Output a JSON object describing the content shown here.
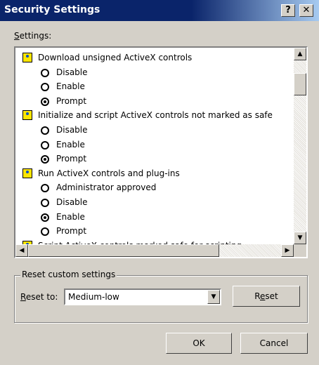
{
  "window": {
    "title": "Security Settings",
    "help_label": "?",
    "close_label": "✕"
  },
  "settings_label_prefix": "S",
  "settings_label_rest": "ettings:",
  "list": {
    "items": [
      {
        "type": "group",
        "label": "Download unsigned ActiveX controls"
      },
      {
        "type": "option",
        "label": "Disable",
        "selected": false
      },
      {
        "type": "option",
        "label": "Enable",
        "selected": false
      },
      {
        "type": "option",
        "label": "Prompt",
        "selected": true
      },
      {
        "type": "group",
        "label": "Initialize and script ActiveX controls not marked as safe"
      },
      {
        "type": "option",
        "label": "Disable",
        "selected": false
      },
      {
        "type": "option",
        "label": "Enable",
        "selected": false
      },
      {
        "type": "option",
        "label": "Prompt",
        "selected": true
      },
      {
        "type": "group",
        "label": "Run ActiveX controls and plug-ins"
      },
      {
        "type": "option",
        "label": "Administrator approved",
        "selected": false
      },
      {
        "type": "option",
        "label": "Disable",
        "selected": false
      },
      {
        "type": "option",
        "label": "Enable",
        "selected": true
      },
      {
        "type": "option",
        "label": "Prompt",
        "selected": false
      },
      {
        "type": "group",
        "label": "Script ActiveX controls marked safe for scripting"
      }
    ]
  },
  "scroll": {
    "up": "▲",
    "down": "▼",
    "left": "◀",
    "right": "▶"
  },
  "reset_group": {
    "title": "Reset custom settings",
    "reset_to_prefix": "R",
    "reset_to_rest": "eset to:",
    "selected": "Medium-low",
    "reset_button_pre": "R",
    "reset_button_u": "e",
    "reset_button_post": "set"
  },
  "buttons": {
    "ok": "OK",
    "cancel": "Cancel"
  }
}
